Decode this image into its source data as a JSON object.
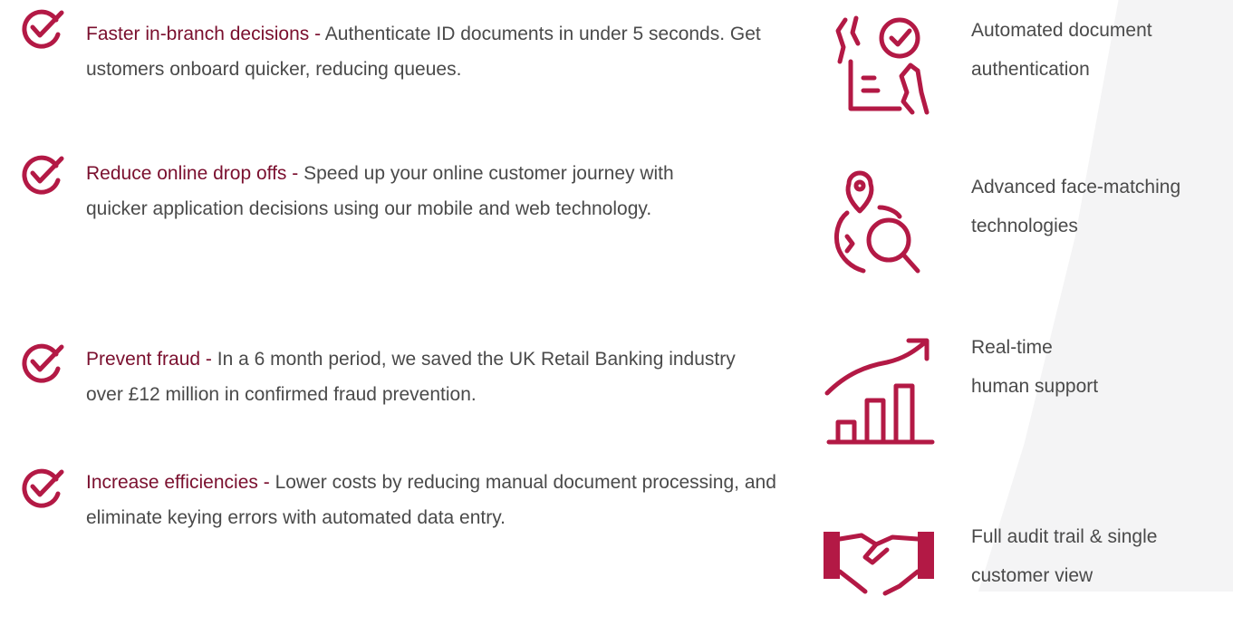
{
  "colors": {
    "accent": "#b31945",
    "title": "#7a0f2e",
    "text": "#4a4a4a"
  },
  "benefits": [
    {
      "icon": "checkmark-icon",
      "title": "Faster in-branch decisions -",
      "text": "Authenticate ID documents in under 5 seconds. Get ustomers onboard quicker, reducing queues."
    },
    {
      "icon": "checkmark-icon",
      "title": "Reduce online drop offs -",
      "text": "Speed up your online customer journey with quicker application decisions using our mobile and web technology."
    },
    {
      "icon": "checkmark-icon",
      "title": "Prevent fraud  -",
      "text": "In a 6 month period, we saved the UK Retail Banking industry over £12 million in confirmed fraud prevention."
    },
    {
      "icon": "checkmark-icon",
      "title": "Increase efficiencies -",
      "text": "Lower costs by reducing manual document processing, and eliminate keying errors with automated data entry."
    }
  ],
  "features": [
    {
      "icon": "document-check-hands-icon",
      "label": "Automated document\nauthentication"
    },
    {
      "icon": "location-face-search-icon",
      "label": "Advanced face-matching\ntechnologies"
    },
    {
      "icon": "growth-chart-icon",
      "label": "Real-time\nhuman support"
    },
    {
      "icon": "handshake-icon",
      "label": "Full audit trail & single\ncustomer view"
    }
  ]
}
